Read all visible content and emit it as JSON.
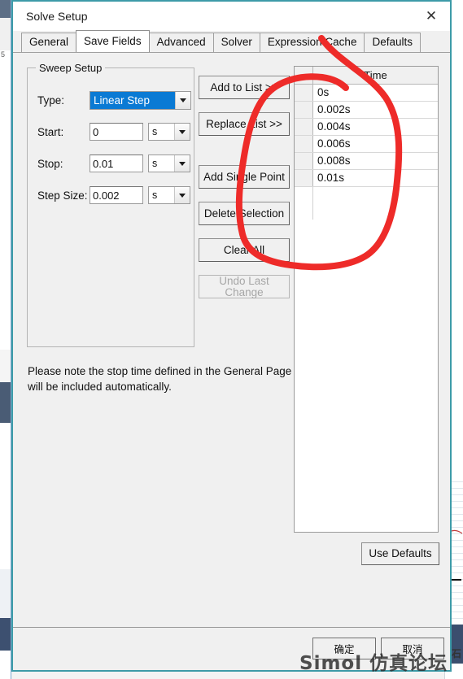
{
  "window": {
    "title": "Solve Setup",
    "close_icon": "close-icon"
  },
  "tabs": [
    {
      "label": "General",
      "active": false
    },
    {
      "label": "Save Fields",
      "active": true
    },
    {
      "label": "Advanced",
      "active": false
    },
    {
      "label": "Solver",
      "active": false
    },
    {
      "label": "Expression Cache",
      "active": false
    },
    {
      "label": "Defaults",
      "active": false
    }
  ],
  "sweep_setup": {
    "group_title": "Sweep Setup",
    "type": {
      "label": "Type:",
      "value": "Linear Step",
      "dropdown_icon": "chevron-down-icon"
    },
    "start": {
      "label": "Start:",
      "value": "0",
      "unit": "s",
      "dropdown_icon": "chevron-down-icon"
    },
    "stop": {
      "label": "Stop:",
      "value": "0.01",
      "unit": "s",
      "dropdown_icon": "chevron-down-icon"
    },
    "step_size": {
      "label": "Step Size:",
      "value": "0.002",
      "unit": "s",
      "dropdown_icon": "chevron-down-icon"
    }
  },
  "actions": {
    "add_to_list": "Add to List >>",
    "replace_list": "Replace List >>",
    "add_single_point": "Add Single Point",
    "delete_selection": "Delete Selection",
    "clear_all": "Clear All",
    "undo_last_change": "Undo Last Change"
  },
  "list": {
    "column_header": "Time",
    "rows": [
      "0s",
      "0.002s",
      "0.004s",
      "0.006s",
      "0.008s",
      "0.01s"
    ]
  },
  "note": "Please note the stop time defined in the General Page will be included automatically.",
  "use_defaults": "Use Defaults",
  "footer": {
    "ok": "确定",
    "cancel": "取消"
  },
  "watermark": "Simol 仿真论坛",
  "background": {
    "line_numbers": [
      "5"
    ],
    "right_glyph": "石"
  },
  "colors": {
    "accent_selection": "#0a7ad4",
    "dialog_border": "#3d9ba8",
    "annotation_red": "#ee2b29",
    "dialog_face": "#f0f0f0"
  }
}
